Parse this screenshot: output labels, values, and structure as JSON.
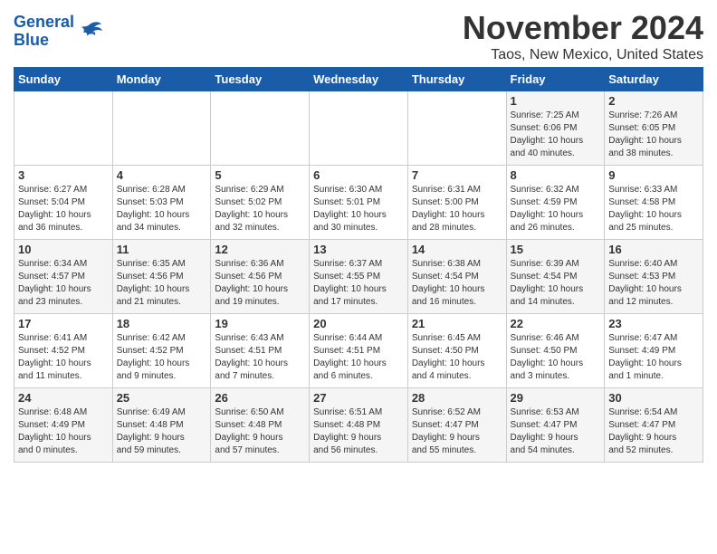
{
  "logo": {
    "line1": "General",
    "line2": "Blue"
  },
  "title": "November 2024",
  "subtitle": "Taos, New Mexico, United States",
  "days_of_week": [
    "Sunday",
    "Monday",
    "Tuesday",
    "Wednesday",
    "Thursday",
    "Friday",
    "Saturday"
  ],
  "weeks": [
    [
      {
        "day": "",
        "info": ""
      },
      {
        "day": "",
        "info": ""
      },
      {
        "day": "",
        "info": ""
      },
      {
        "day": "",
        "info": ""
      },
      {
        "day": "",
        "info": ""
      },
      {
        "day": "1",
        "info": "Sunrise: 7:25 AM\nSunset: 6:06 PM\nDaylight: 10 hours\nand 40 minutes."
      },
      {
        "day": "2",
        "info": "Sunrise: 7:26 AM\nSunset: 6:05 PM\nDaylight: 10 hours\nand 38 minutes."
      }
    ],
    [
      {
        "day": "3",
        "info": "Sunrise: 6:27 AM\nSunset: 5:04 PM\nDaylight: 10 hours\nand 36 minutes."
      },
      {
        "day": "4",
        "info": "Sunrise: 6:28 AM\nSunset: 5:03 PM\nDaylight: 10 hours\nand 34 minutes."
      },
      {
        "day": "5",
        "info": "Sunrise: 6:29 AM\nSunset: 5:02 PM\nDaylight: 10 hours\nand 32 minutes."
      },
      {
        "day": "6",
        "info": "Sunrise: 6:30 AM\nSunset: 5:01 PM\nDaylight: 10 hours\nand 30 minutes."
      },
      {
        "day": "7",
        "info": "Sunrise: 6:31 AM\nSunset: 5:00 PM\nDaylight: 10 hours\nand 28 minutes."
      },
      {
        "day": "8",
        "info": "Sunrise: 6:32 AM\nSunset: 4:59 PM\nDaylight: 10 hours\nand 26 minutes."
      },
      {
        "day": "9",
        "info": "Sunrise: 6:33 AM\nSunset: 4:58 PM\nDaylight: 10 hours\nand 25 minutes."
      }
    ],
    [
      {
        "day": "10",
        "info": "Sunrise: 6:34 AM\nSunset: 4:57 PM\nDaylight: 10 hours\nand 23 minutes."
      },
      {
        "day": "11",
        "info": "Sunrise: 6:35 AM\nSunset: 4:56 PM\nDaylight: 10 hours\nand 21 minutes."
      },
      {
        "day": "12",
        "info": "Sunrise: 6:36 AM\nSunset: 4:56 PM\nDaylight: 10 hours\nand 19 minutes."
      },
      {
        "day": "13",
        "info": "Sunrise: 6:37 AM\nSunset: 4:55 PM\nDaylight: 10 hours\nand 17 minutes."
      },
      {
        "day": "14",
        "info": "Sunrise: 6:38 AM\nSunset: 4:54 PM\nDaylight: 10 hours\nand 16 minutes."
      },
      {
        "day": "15",
        "info": "Sunrise: 6:39 AM\nSunset: 4:54 PM\nDaylight: 10 hours\nand 14 minutes."
      },
      {
        "day": "16",
        "info": "Sunrise: 6:40 AM\nSunset: 4:53 PM\nDaylight: 10 hours\nand 12 minutes."
      }
    ],
    [
      {
        "day": "17",
        "info": "Sunrise: 6:41 AM\nSunset: 4:52 PM\nDaylight: 10 hours\nand 11 minutes."
      },
      {
        "day": "18",
        "info": "Sunrise: 6:42 AM\nSunset: 4:52 PM\nDaylight: 10 hours\nand 9 minutes."
      },
      {
        "day": "19",
        "info": "Sunrise: 6:43 AM\nSunset: 4:51 PM\nDaylight: 10 hours\nand 7 minutes."
      },
      {
        "day": "20",
        "info": "Sunrise: 6:44 AM\nSunset: 4:51 PM\nDaylight: 10 hours\nand 6 minutes."
      },
      {
        "day": "21",
        "info": "Sunrise: 6:45 AM\nSunset: 4:50 PM\nDaylight: 10 hours\nand 4 minutes."
      },
      {
        "day": "22",
        "info": "Sunrise: 6:46 AM\nSunset: 4:50 PM\nDaylight: 10 hours\nand 3 minutes."
      },
      {
        "day": "23",
        "info": "Sunrise: 6:47 AM\nSunset: 4:49 PM\nDaylight: 10 hours\nand 1 minute."
      }
    ],
    [
      {
        "day": "24",
        "info": "Sunrise: 6:48 AM\nSunset: 4:49 PM\nDaylight: 10 hours\nand 0 minutes."
      },
      {
        "day": "25",
        "info": "Sunrise: 6:49 AM\nSunset: 4:48 PM\nDaylight: 9 hours\nand 59 minutes."
      },
      {
        "day": "26",
        "info": "Sunrise: 6:50 AM\nSunset: 4:48 PM\nDaylight: 9 hours\nand 57 minutes."
      },
      {
        "day": "27",
        "info": "Sunrise: 6:51 AM\nSunset: 4:48 PM\nDaylight: 9 hours\nand 56 minutes."
      },
      {
        "day": "28",
        "info": "Sunrise: 6:52 AM\nSunset: 4:47 PM\nDaylight: 9 hours\nand 55 minutes."
      },
      {
        "day": "29",
        "info": "Sunrise: 6:53 AM\nSunset: 4:47 PM\nDaylight: 9 hours\nand 54 minutes."
      },
      {
        "day": "30",
        "info": "Sunrise: 6:54 AM\nSunset: 4:47 PM\nDaylight: 9 hours\nand 52 minutes."
      }
    ]
  ]
}
